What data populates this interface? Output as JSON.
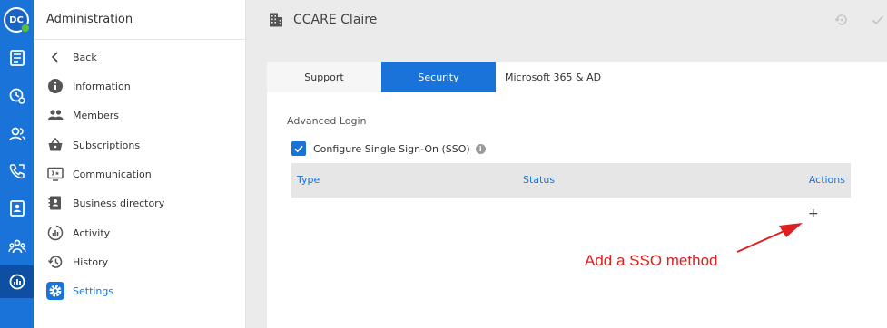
{
  "user": {
    "initials": "DC",
    "online_color": "#5cc236"
  },
  "colors": {
    "accent": "#1a73d9",
    "annotation": "#e02020"
  },
  "rail": {
    "items": [
      {
        "icon": "newspaper-icon"
      },
      {
        "icon": "clock-settings-icon"
      },
      {
        "icon": "contacts-icon"
      },
      {
        "icon": "phone-icon"
      },
      {
        "icon": "contact-card-icon"
      },
      {
        "icon": "groups-icon"
      },
      {
        "icon": "analytics-icon",
        "active": true
      }
    ]
  },
  "sidebar": {
    "title": "Administration",
    "items": [
      {
        "label": "Back",
        "icon": "chevron-left-icon"
      },
      {
        "label": "Information",
        "icon": "info-icon"
      },
      {
        "label": "Members",
        "icon": "members-icon"
      },
      {
        "label": "Subscriptions",
        "icon": "basket-icon"
      },
      {
        "label": "Communication",
        "icon": "communication-icon"
      },
      {
        "label": "Business directory",
        "icon": "directory-icon"
      },
      {
        "label": "Activity",
        "icon": "activity-icon"
      },
      {
        "label": "History",
        "icon": "history-icon"
      },
      {
        "label": "Settings",
        "icon": "gear-icon",
        "active": true
      }
    ]
  },
  "header": {
    "title": "CCARE Claire",
    "icon": "building-icon"
  },
  "tabs": [
    {
      "label": "Support"
    },
    {
      "label": "Security",
      "active": true
    },
    {
      "label": "Microsoft 365 & AD"
    }
  ],
  "security": {
    "section_title": "Advanced Login",
    "sso_checkbox": {
      "label": "Configure Single Sign-On (SSO)",
      "checked": true
    },
    "table": {
      "columns": [
        "Type",
        "Status",
        "Actions"
      ],
      "add_label": "+"
    }
  },
  "annotation": {
    "text": "Add a SSO method"
  }
}
